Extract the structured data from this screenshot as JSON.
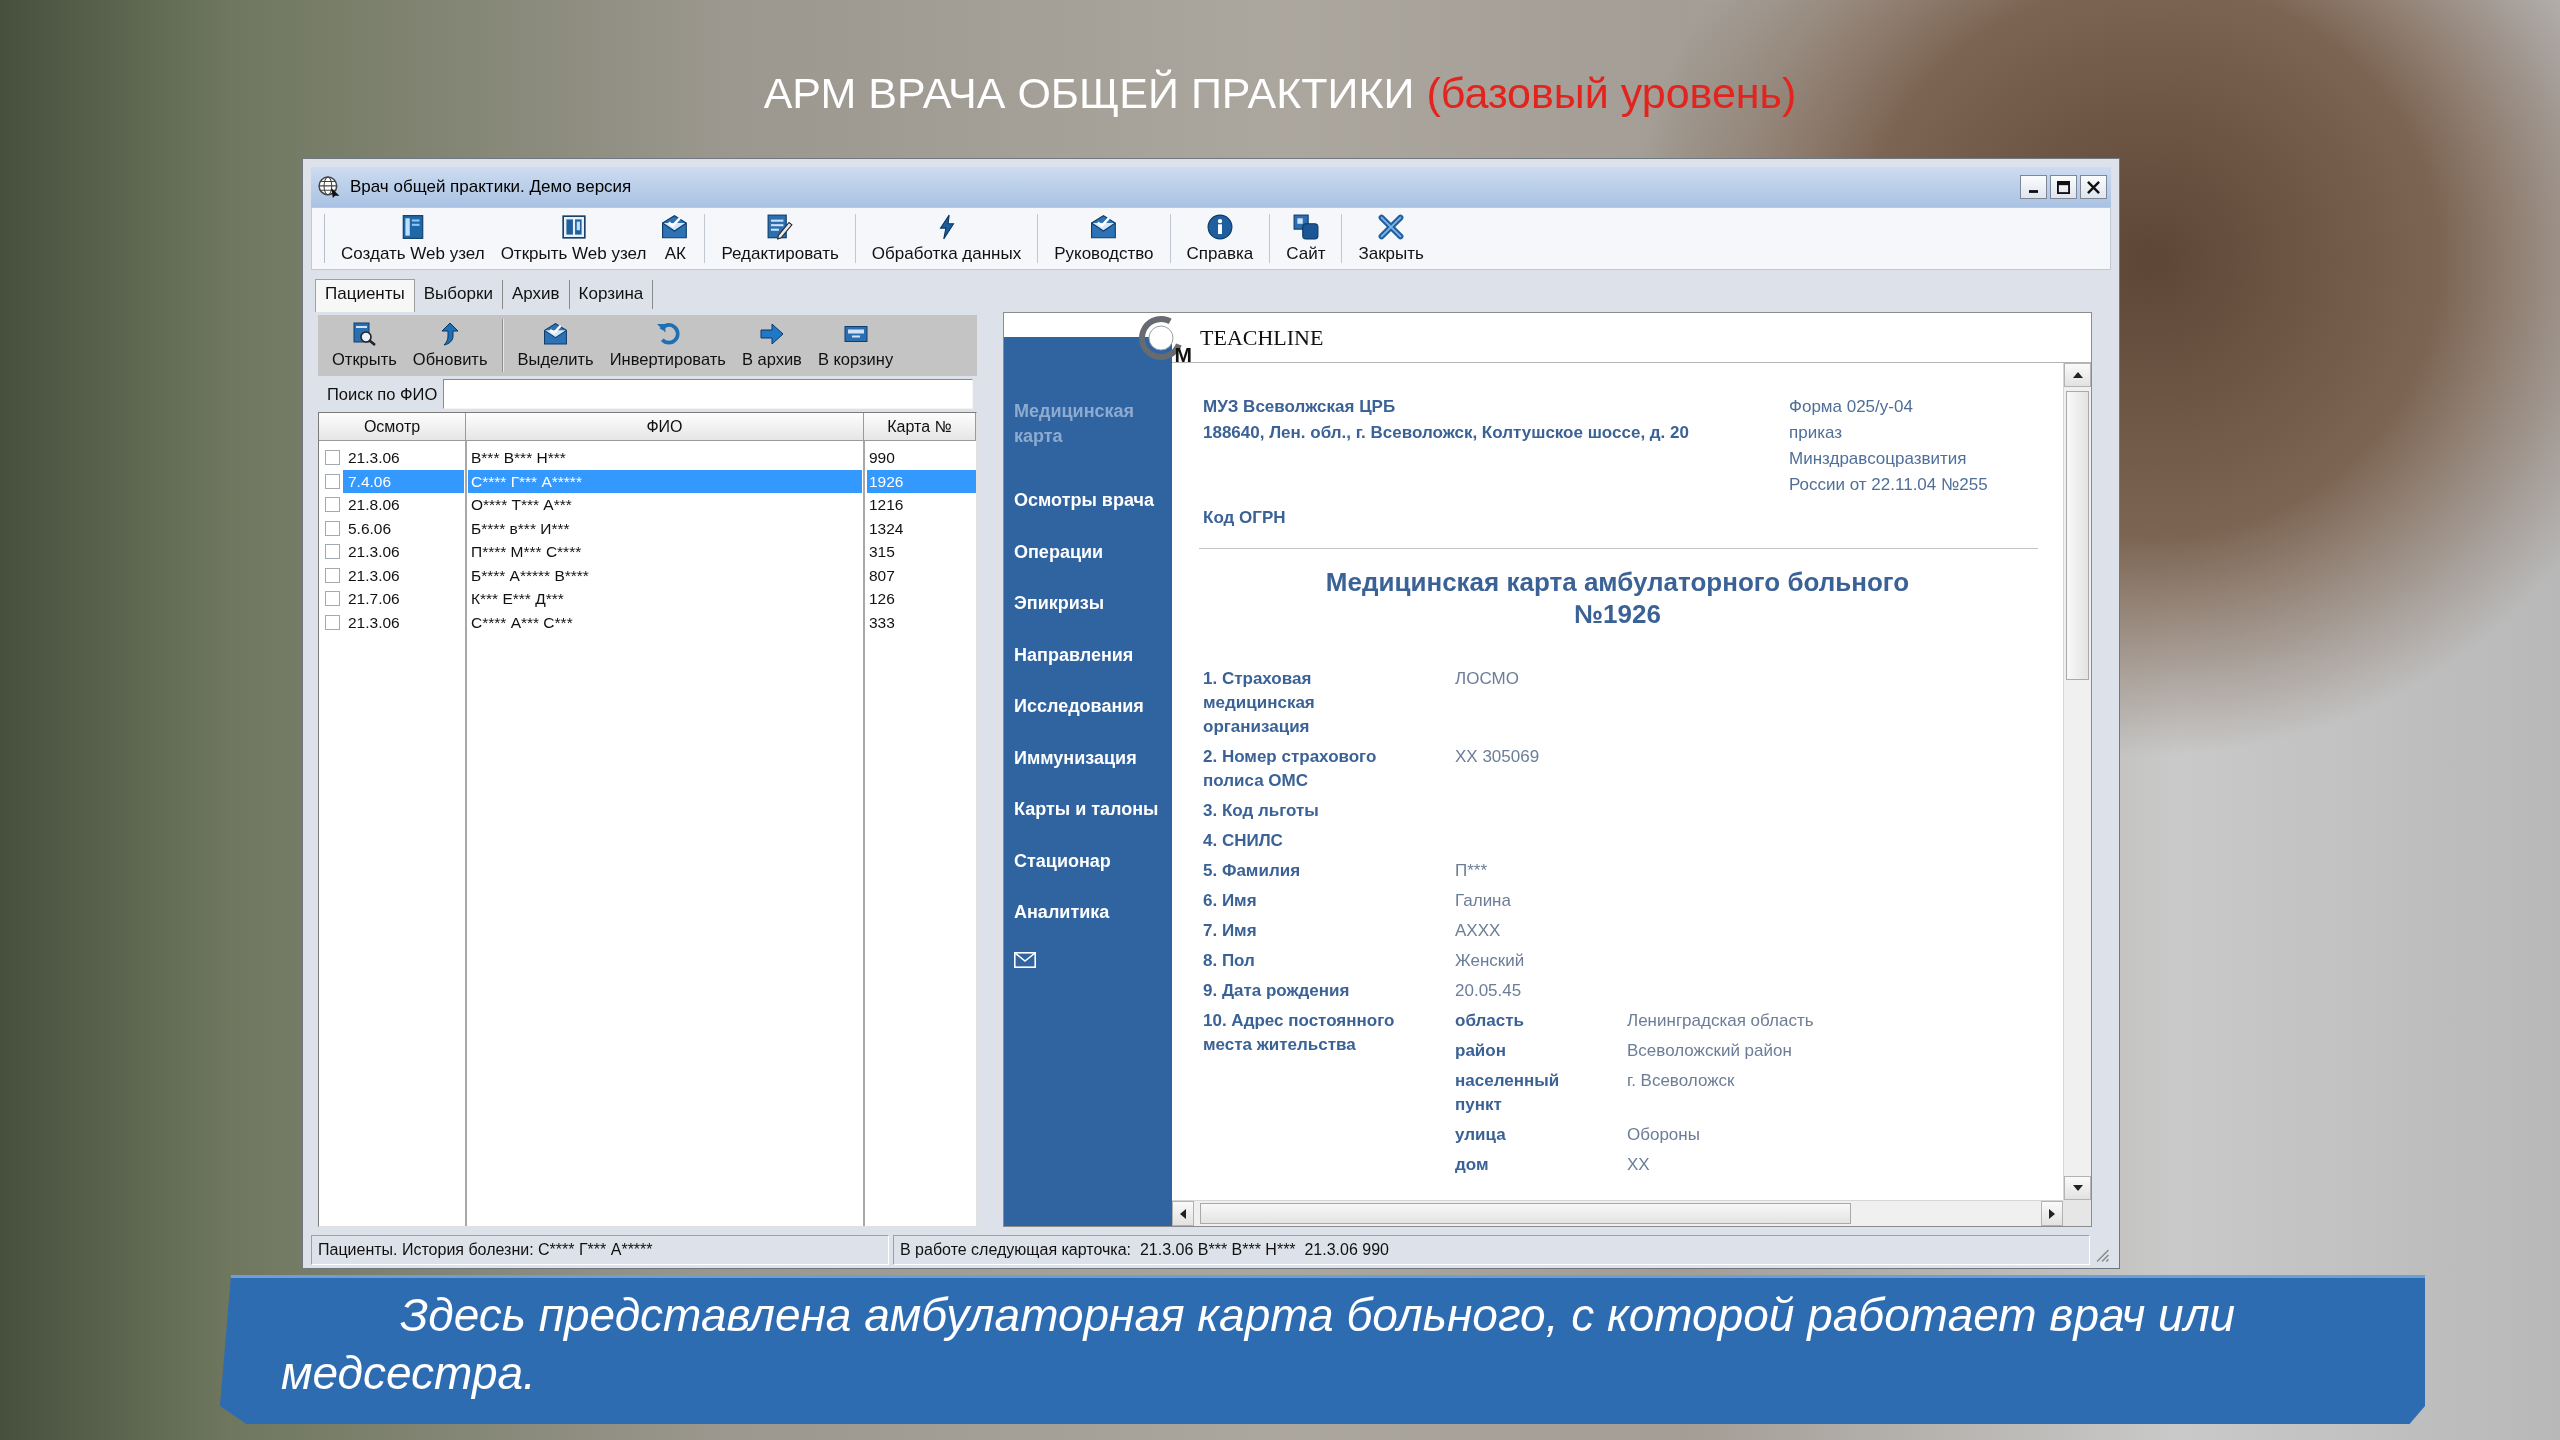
{
  "slide": {
    "title": "АРМ ВРАЧА ОБЩЕЙ ПРАКТИКИ",
    "title_note": "(базовый уровень)",
    "caption": "Здесь представлена амбулаторная карта больного, с которой работает врач или медсестра."
  },
  "window": {
    "title": "Врач общей практики. Демо версия"
  },
  "toolbar": [
    [
      "Создать Web узел",
      "Открыть Web узел",
      "АК"
    ],
    [
      "Редактировать"
    ],
    [
      "Обработка данных"
    ],
    [
      "Руководство"
    ],
    [
      "Справка"
    ],
    [
      "Сайт"
    ],
    [
      "Закрыть"
    ]
  ],
  "tabs": [
    {
      "label": "Пациенты",
      "selected": true
    },
    {
      "label": "Выборки",
      "selected": false
    },
    {
      "label": "Архив",
      "selected": false
    },
    {
      "label": "Корзина",
      "selected": false
    }
  ],
  "patients": {
    "toolbar": [
      [
        "Открыть",
        "Обновить"
      ],
      [
        "Выделить",
        "Инвертировать",
        "В архив",
        "В корзину"
      ]
    ],
    "search": {
      "label": "Поиск по ФИО"
    },
    "table": {
      "columns": [
        "Осмотр",
        "ФИО",
        "Карта №"
      ],
      "rows": [
        {
          "date": "21.3.06",
          "name": "В*** В*** Н***",
          "card": "990",
          "checked": false,
          "selected": false
        },
        {
          "date": "7.4.06",
          "name": "С**** Г*** А*****",
          "card": "1926",
          "checked": false,
          "selected": true
        },
        {
          "date": "21.8.06",
          "name": "О**** Т*** А***",
          "card": "1216",
          "checked": false,
          "selected": false
        },
        {
          "date": "5.6.06",
          "name": "Б**** в*** И***",
          "card": "1324",
          "checked": false,
          "selected": false
        },
        {
          "date": "21.3.06",
          "name": "П**** М*** С****",
          "card": "315",
          "checked": false,
          "selected": false
        },
        {
          "date": "21.3.06",
          "name": "Б**** А***** В****",
          "card": "807",
          "checked": false,
          "selected": false
        },
        {
          "date": "21.7.06",
          "name": "К*** Е*** Д***",
          "card": "126",
          "checked": false,
          "selected": false
        },
        {
          "date": "21.3.06",
          "name": "С**** А*** С***",
          "card": "333",
          "checked": false,
          "selected": false
        }
      ]
    }
  },
  "card": {
    "logo_letter": "M",
    "brand": "TEACHLINE",
    "nav": [
      {
        "label": "Медицинская карта",
        "selected": true
      },
      {
        "label": "Осмотры врача",
        "selected": false
      },
      {
        "label": "Операции",
        "selected": false
      },
      {
        "label": "Эпикризы",
        "selected": false
      },
      {
        "label": "Направления",
        "selected": false
      },
      {
        "label": "Исследования",
        "selected": false
      },
      {
        "label": "Иммунизация",
        "selected": false
      },
      {
        "label": "Карты и талоны",
        "selected": false
      },
      {
        "label": "Стационар",
        "selected": false
      },
      {
        "label": "Аналитика",
        "selected": false
      }
    ],
    "organization": "МУЗ Всеволжская ЦРБ",
    "organization_address": "188640, Лен. обл., г. Всеволожск, Колтушское шоссе, д. 20",
    "form_reference": [
      "Форма 025/у-04",
      "приказ",
      "Минздравсоцразвития",
      "России от 22.11.04 №255"
    ],
    "ogrn_label": "Код ОГРН",
    "title_lines": [
      "Медицинская карта амбулаторного больного",
      "№1926"
    ],
    "fields": [
      {
        "label": "1. Страховая медицинская организация",
        "value": "ЛОСМО"
      },
      {
        "label": "2. Номер страхового полиса ОМС",
        "value": "XX 305069"
      },
      {
        "label": "3. Код льготы"
      },
      {
        "label": "4. СНИЛС"
      },
      {
        "label": "5. Фамилия",
        "value": "П***"
      },
      {
        "label": "6. Имя",
        "value": "Галина"
      },
      {
        "label": "7. Имя",
        "value": "AXXX"
      },
      {
        "label": "8. Пол",
        "value": "Женский"
      },
      {
        "label": "9. Дата рождения",
        "value": "20.05.45"
      }
    ],
    "residence": {
      "label": "10. Адрес постоянного места жительства",
      "parts": [
        {
          "label": "область",
          "value": "Ленинградская область"
        },
        {
          "label": "район",
          "value": "Всеволожский район"
        },
        {
          "label": "населенный пункт",
          "value": "г. Всеволожск"
        },
        {
          "label": "улица",
          "value": "Обороны"
        },
        {
          "label": "дом",
          "value": "XX"
        }
      ]
    }
  },
  "status_bar": [
    "Пациенты. История болезни: С**** Г*** А*****",
    "В работе следующая карточка:  21.3.06 В*** В*** Н***  21.3.06 990"
  ]
}
